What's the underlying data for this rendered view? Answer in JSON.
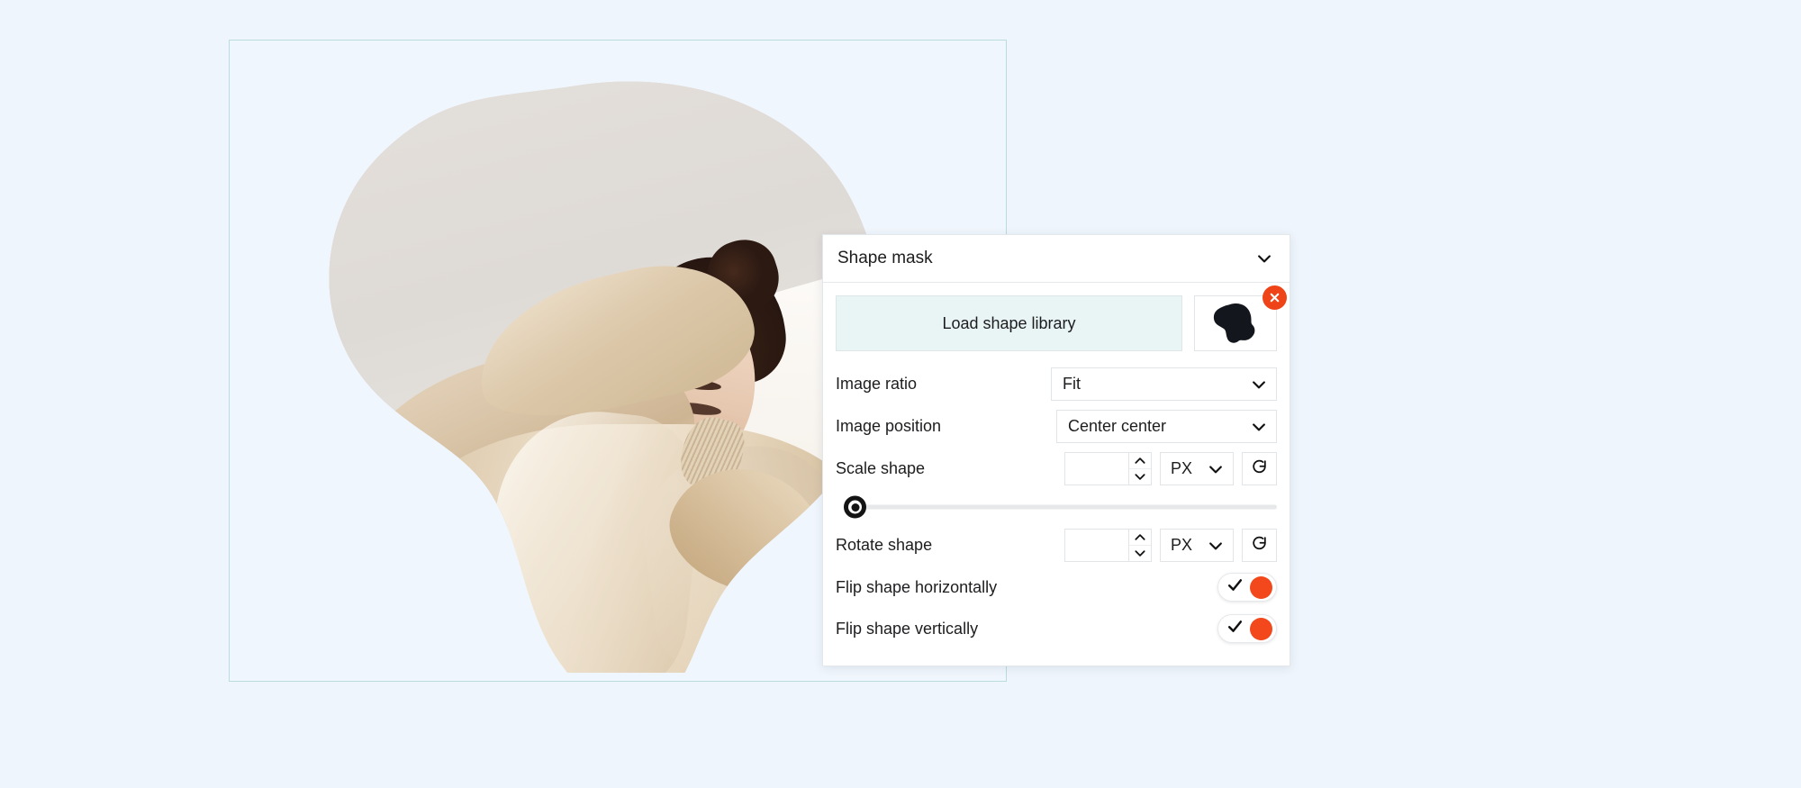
{
  "background_color": "#eff5fc",
  "canvas": {
    "name": "design-canvas",
    "border_color": "#b9dcdc",
    "masked_image_alt": "Woman pulling a beige knit sweater over her head, clipped to a blob shape mask"
  },
  "panel": {
    "title": "Shape mask",
    "collapse_icon": "chevron-down-icon",
    "load_shape_button": "Load shape library",
    "shape_thumbnail_icon": "blob-shape-icon",
    "remove_shape_icon": "close-circle-icon",
    "accent_color": "#ef4417",
    "rows": {
      "image_ratio": {
        "label": "Image ratio",
        "value": "Fit",
        "dropdown_icon": "chevron-down-icon"
      },
      "image_position": {
        "label": "Image position",
        "value": "Center center",
        "dropdown_icon": "chevron-down-icon"
      },
      "scale_shape": {
        "label": "Scale shape",
        "value": "",
        "placeholder": "",
        "unit": "PX",
        "unit_dropdown_icon": "chevron-down-icon",
        "stepper_up_icon": "chevron-up-icon",
        "stepper_down_icon": "chevron-down-icon",
        "reset_icon": "refresh-icon",
        "slider_value": 0
      },
      "rotate_shape": {
        "label": "Rotate shape",
        "value": "",
        "placeholder": "",
        "unit": "PX",
        "unit_dropdown_icon": "chevron-down-icon",
        "stepper_up_icon": "chevron-up-icon",
        "stepper_down_icon": "chevron-down-icon",
        "reset_icon": "refresh-icon"
      },
      "flip_horizontal": {
        "label": "Flip shape horizontally",
        "state": "on",
        "check_icon": "check-icon"
      },
      "flip_vertical": {
        "label": "Flip shape vertically",
        "state": "on",
        "check_icon": "check-icon"
      }
    }
  }
}
